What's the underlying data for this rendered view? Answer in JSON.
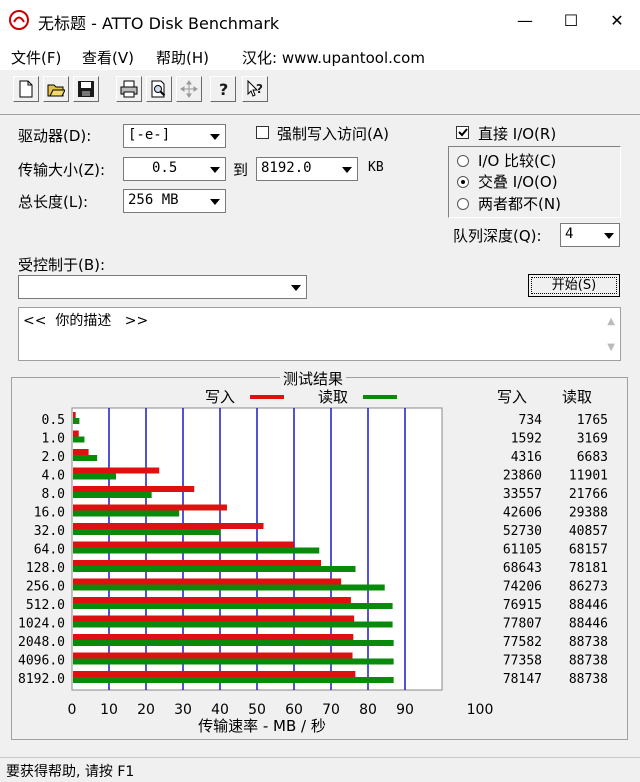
{
  "window": {
    "title": "无标题 - ATTO Disk Benchmark",
    "minimize_glyph": "—",
    "maximize_glyph": "☐",
    "close_glyph": "✕"
  },
  "menu": {
    "file": "文件(F)",
    "view": "查看(V)",
    "help": "帮助(H)",
    "localized": "汉化: www.upantool.com"
  },
  "toolbar": {
    "icons": [
      "new-file-icon",
      "open-folder-icon",
      "save-icon",
      "print-icon",
      "print-preview-icon",
      "move-icon",
      "help-icon",
      "context-help-icon"
    ]
  },
  "form": {
    "drive_label": "驱动器(D):",
    "drive_value": "[-e-]",
    "force_write_label": "强制写入访问(A)",
    "force_write_checked": false,
    "direct_io_label": "直接 I/O(R)",
    "direct_io_checked": true,
    "transfer_label": "传输大小(Z):",
    "transfer_from": "0.5",
    "to_label": "到",
    "transfer_to": "8192.0",
    "kb_label": "KB",
    "total_label": "总长度(L):",
    "total_value": "256 MB",
    "io_compare": "I/O 比较(C)",
    "overlapped_io": "交叠 I/O(O)",
    "neither": "两者都不(N)",
    "selected_io": "overlapped",
    "queue_label": "队列深度(Q):",
    "queue_value": "4",
    "controlled_by_label": "受控制于(B):",
    "controlled_by_value": "",
    "start_button": "开始(S)",
    "description": "<<  你的描述   >>"
  },
  "chart_data": {
    "type": "bar",
    "title": "测试结果",
    "orientation": "horizontal",
    "xlabel": "传输速率 - MB / 秒",
    "xlim": [
      0,
      100
    ],
    "xticks": [
      "0",
      "10",
      "20",
      "30",
      "40",
      "50",
      "60",
      "70",
      "80",
      "90",
      "100"
    ],
    "categories": [
      "0.5",
      "1.0",
      "2.0",
      "4.0",
      "8.0",
      "16.0",
      "32.0",
      "64.0",
      "128.0",
      "256.0",
      "512.0",
      "1024.0",
      "2048.0",
      "4096.0",
      "8192.0"
    ],
    "series": [
      {
        "name": "写入",
        "color": "#e01010",
        "values": [
          734,
          1592,
          4316,
          23860,
          33557,
          42606,
          52730,
          61105,
          68643,
          74206,
          76915,
          77807,
          77582,
          77358,
          78147
        ]
      },
      {
        "name": "读取",
        "color": "#0a8a0a",
        "values": [
          1765,
          3169,
          6683,
          11901,
          21766,
          29388,
          40857,
          68157,
          78181,
          86273,
          88446,
          88446,
          88738,
          88738,
          88738
        ]
      }
    ],
    "value_scale_note": "KB/s",
    "table_headers": [
      "写入",
      "读取"
    ],
    "grid": true,
    "legend_position": "top"
  },
  "status": {
    "text": "要获得帮助, 请按 F1"
  }
}
